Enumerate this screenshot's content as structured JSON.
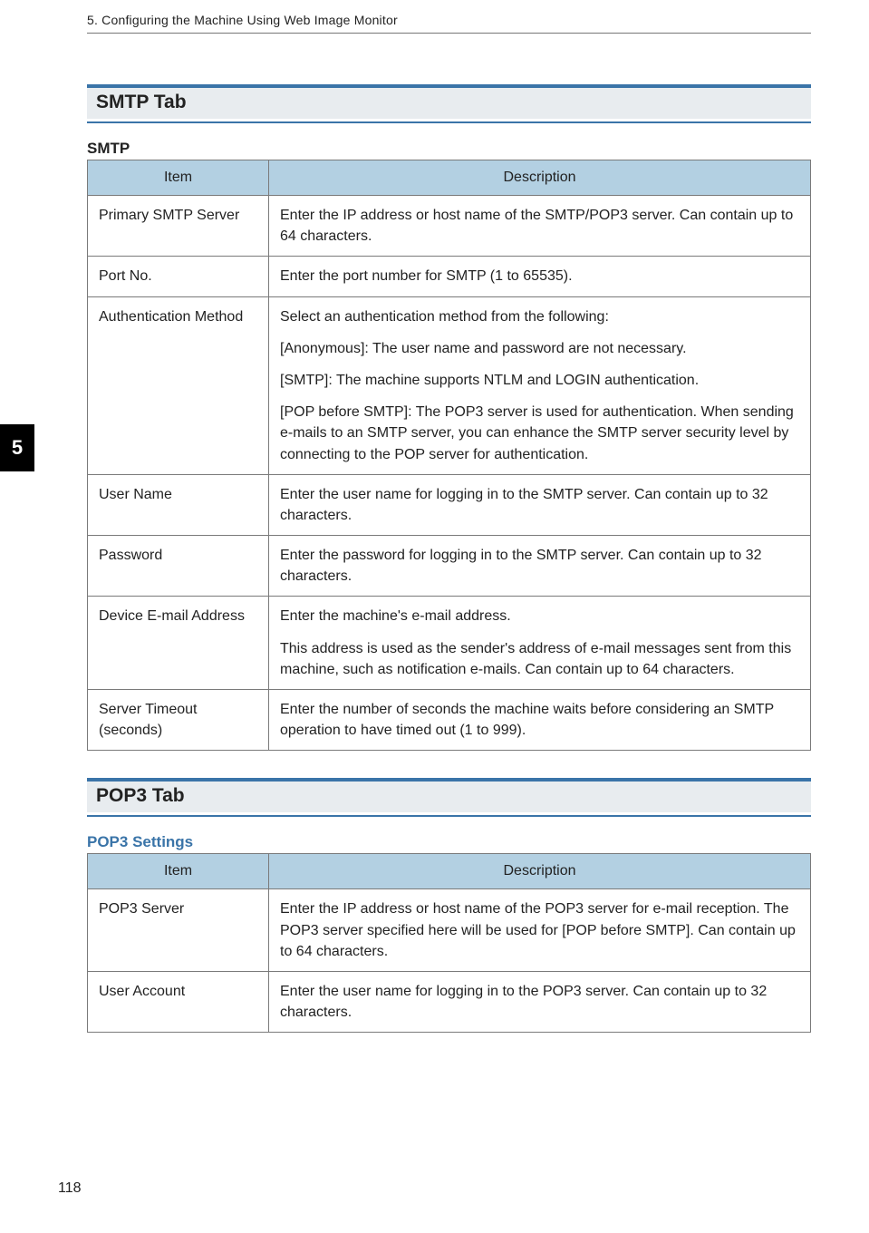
{
  "running_head": "5. Configuring the Machine Using Web Image Monitor",
  "side_tab": "5",
  "page_number": "118",
  "columns": {
    "item": "Item",
    "description": "Description"
  },
  "sections": {
    "smtp": {
      "title": "SMTP Tab",
      "sub_title": "SMTP",
      "rows": [
        {
          "item": "Primary SMTP Server",
          "paras": [
            "Enter the IP address or host name of the SMTP/POP3 server. Can contain up to 64 characters."
          ]
        },
        {
          "item": "Port No.",
          "paras": [
            "Enter the port number for SMTP (1 to 65535)."
          ]
        },
        {
          "item": "Authentication Method",
          "paras": [
            "Select an authentication method from the following:",
            "[Anonymous]: The user name and password are not necessary.",
            "[SMTP]: The machine supports NTLM and LOGIN authentication.",
            "[POP before SMTP]: The POP3 server is used for authentication. When sending e-mails to an SMTP server, you can enhance the SMTP server security level by connecting to the POP server for authentication."
          ]
        },
        {
          "item": "User Name",
          "paras": [
            "Enter the user name for logging in to the SMTP server. Can contain up to 32 characters."
          ]
        },
        {
          "item": "Password",
          "paras": [
            "Enter the password for logging in to the SMTP server. Can contain up to 32 characters."
          ]
        },
        {
          "item": "Device E-mail Address",
          "paras": [
            "Enter the machine's e-mail address.",
            "This address is used as the sender's address of e-mail messages sent from this machine, such as notification e-mails. Can contain up to 64 characters."
          ]
        },
        {
          "item": "Server Timeout (seconds)",
          "paras": [
            "Enter the number of seconds the machine waits before considering an SMTP operation to have timed out (1 to 999)."
          ]
        }
      ]
    },
    "pop3": {
      "title": "POP3 Tab",
      "sub_title": "POP3 Settings",
      "rows": [
        {
          "item": "POP3 Server",
          "paras": [
            "Enter the IP address or host name of the POP3 server for e-mail reception. The POP3 server specified here will be used for [POP before SMTP]. Can contain up to 64 characters."
          ]
        },
        {
          "item": "User Account",
          "paras": [
            "Enter the user name for logging in to the POP3 server. Can contain up to 32 characters."
          ]
        }
      ]
    }
  }
}
